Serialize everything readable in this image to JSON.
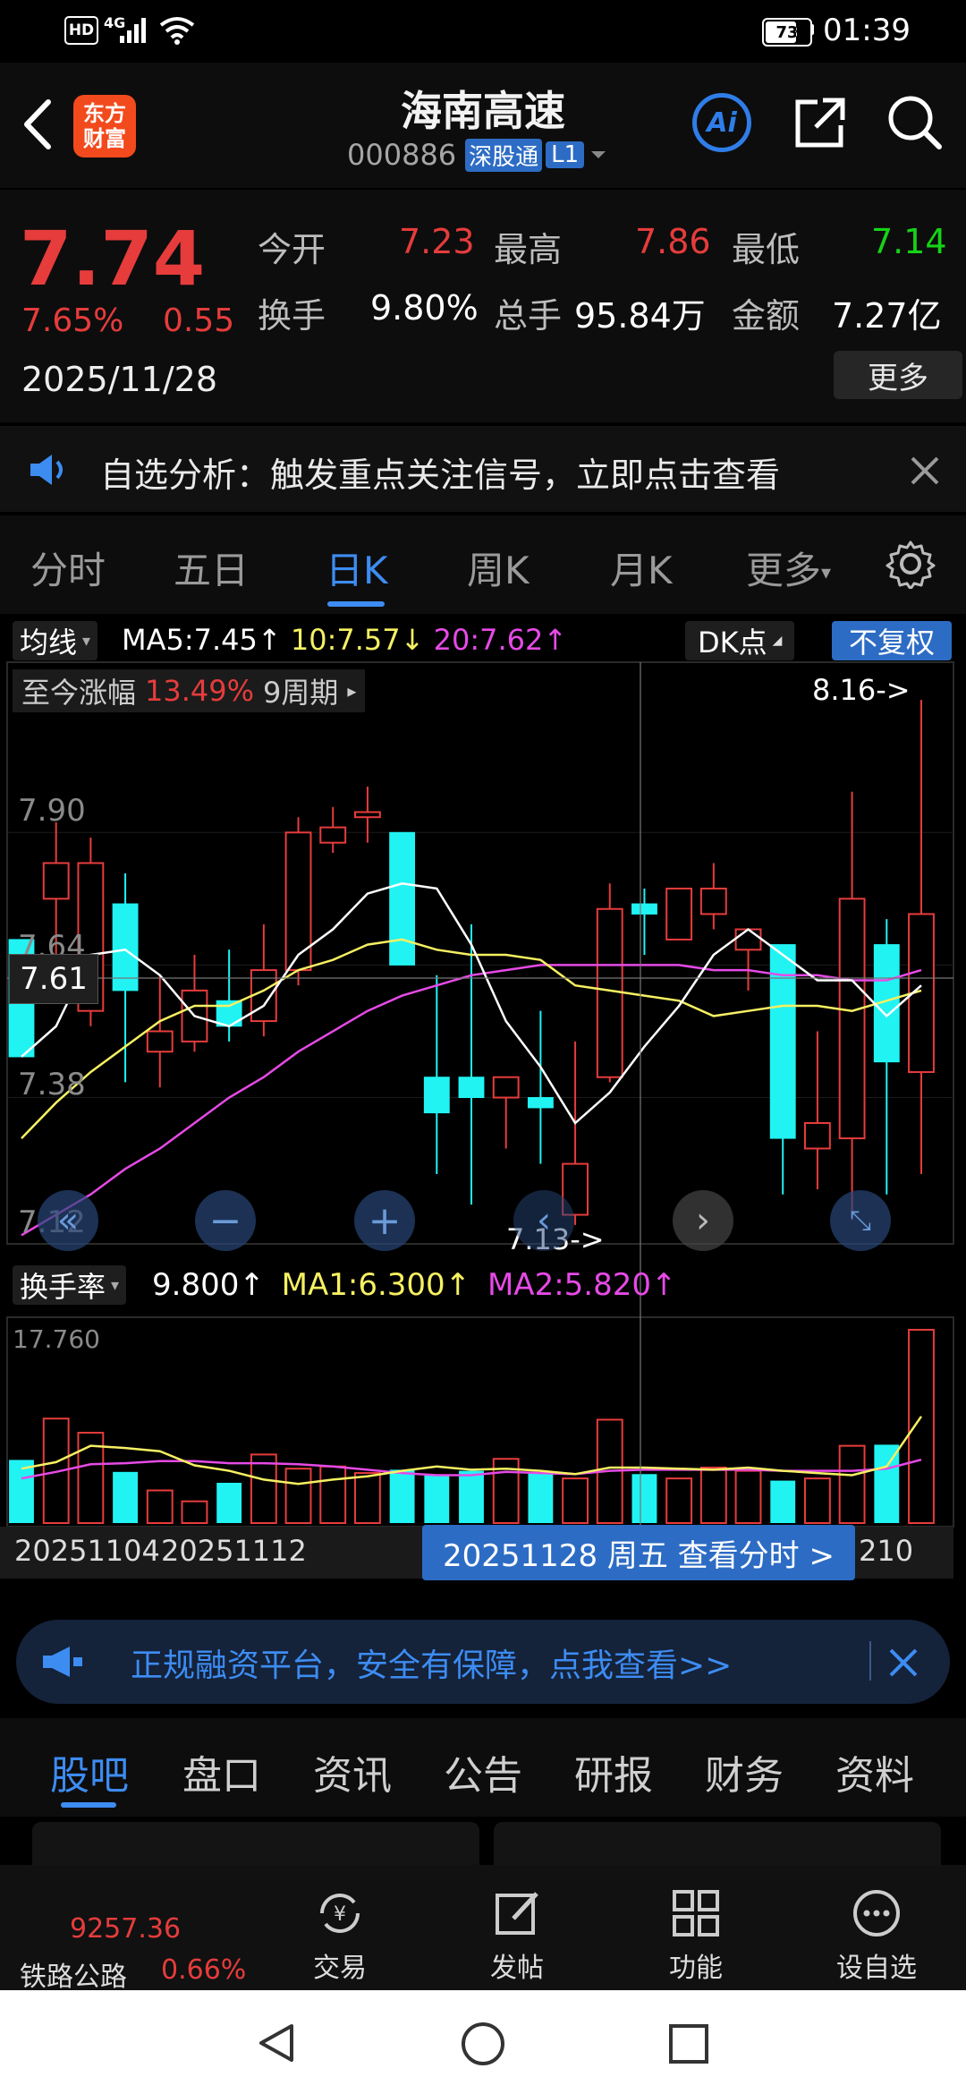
{
  "status": {
    "time": "01:39",
    "battery": "73",
    "network": "4G",
    "hd": "HD"
  },
  "header": {
    "logo_line1": "东方",
    "logo_line2": "财富",
    "stock_name": "海南高速",
    "stock_code": "000886",
    "tag_market": "深股通",
    "tag_level": "L1",
    "ai_label": "Ai"
  },
  "quote": {
    "price": "7.74",
    "change_pct": "7.65%",
    "change_abs": "0.55",
    "date": "2025/11/28",
    "open_label": "今开",
    "open": "7.23",
    "high_label": "最高",
    "high": "7.86",
    "low_label": "最低",
    "low": "7.14",
    "turnover_label": "换手",
    "turnover": "9.80%",
    "volume_label": "总手",
    "volume": "95.84万",
    "amount_label": "金额",
    "amount": "7.27亿",
    "more_label": "更多"
  },
  "notice": {
    "text": "自选分析：触发重点关注信号，立即点击查看"
  },
  "tabs": {
    "items": [
      "分时",
      "五日",
      "日K",
      "周K",
      "月K",
      "更多"
    ],
    "active": "日K"
  },
  "kline": {
    "indicator_label": "均线",
    "ma5": "MA5:7.45↑",
    "ma10": "10:7.57↓",
    "ma20": "20:7.62↑",
    "dk_label": "DK点",
    "adjust_label": "不复权",
    "period_label": "至今涨幅",
    "period_pct": "13.49%",
    "period_cycle": "9周期",
    "high_marker": "8.16->",
    "low_marker": "7.13->",
    "y_ticks": [
      "7.90",
      "7.64",
      "7.38",
      "7.12"
    ],
    "crosshair_price": "7.61",
    "sub_indicator": "换手率",
    "sub_val": "9.800↑",
    "sub_ma1": "MA1:6.300↑",
    "sub_ma2": "MA2:5.820↑",
    "sub_max": "17.760",
    "x_labels": [
      "20251104",
      "20251112",
      "210"
    ],
    "tooltip": "20251128 周五 查看分时 >",
    "colors": {
      "up": "#e63c3c",
      "down": "#21f3f3",
      "ma5": "#ffffff",
      "ma10": "#f6f062",
      "ma20": "#e64ae6"
    }
  },
  "chart_data": {
    "type": "candlestick",
    "series": [
      {
        "o": 7.69,
        "h": 7.69,
        "l": 7.46,
        "c": 7.46
      },
      {
        "o": 7.77,
        "h": 7.92,
        "l": 7.6,
        "c": 7.84
      },
      {
        "o": 7.55,
        "h": 7.89,
        "l": 7.52,
        "c": 7.84
      },
      {
        "o": 7.76,
        "h": 7.82,
        "l": 7.41,
        "c": 7.59
      },
      {
        "o": 7.47,
        "h": 7.62,
        "l": 7.4,
        "c": 7.51
      },
      {
        "o": 7.49,
        "h": 7.66,
        "l": 7.47,
        "c": 7.59
      },
      {
        "o": 7.57,
        "h": 7.67,
        "l": 7.49,
        "c": 7.52
      },
      {
        "o": 7.53,
        "h": 7.72,
        "l": 7.5,
        "c": 7.63
      },
      {
        "o": 7.63,
        "h": 7.93,
        "l": 7.6,
        "c": 7.9
      },
      {
        "o": 7.88,
        "h": 7.95,
        "l": 7.86,
        "c": 7.91
      },
      {
        "o": 7.93,
        "h": 7.99,
        "l": 7.88,
        "c": 7.94
      },
      {
        "o": 7.9,
        "h": 7.9,
        "l": 7.64,
        "c": 7.64
      },
      {
        "o": 7.42,
        "h": 7.62,
        "l": 7.23,
        "c": 7.35
      },
      {
        "o": 7.42,
        "h": 7.72,
        "l": 7.17,
        "c": 7.38
      },
      {
        "o": 7.38,
        "h": 7.41,
        "l": 7.28,
        "c": 7.42
      },
      {
        "o": 7.38,
        "h": 7.55,
        "l": 7.25,
        "c": 7.36
      },
      {
        "o": 7.15,
        "h": 7.49,
        "l": 7.13,
        "c": 7.25
      },
      {
        "o": 7.42,
        "h": 7.8,
        "l": 7.41,
        "c": 7.75
      },
      {
        "o": 7.76,
        "h": 7.79,
        "l": 7.66,
        "c": 7.74
      },
      {
        "o": 7.69,
        "h": 7.77,
        "l": 7.69,
        "c": 7.79
      },
      {
        "o": 7.74,
        "h": 7.84,
        "l": 7.71,
        "c": 7.79
      },
      {
        "o": 7.67,
        "h": 7.71,
        "l": 7.59,
        "c": 7.71
      },
      {
        "o": 7.68,
        "h": 7.68,
        "l": 7.19,
        "c": 7.3
      },
      {
        "o": 7.28,
        "h": 7.51,
        "l": 7.2,
        "c": 7.33
      },
      {
        "o": 7.3,
        "h": 7.98,
        "l": 7.14,
        "c": 7.77
      },
      {
        "o": 7.68,
        "h": 7.73,
        "l": 7.19,
        "c": 7.45
      },
      {
        "o": 7.43,
        "h": 8.16,
        "l": 7.23,
        "c": 7.74
      }
    ],
    "ma5": [
      7.46,
      7.52,
      7.66,
      7.67,
      7.62,
      7.54,
      7.52,
      7.56,
      7.66,
      7.71,
      7.78,
      7.8,
      7.79,
      7.68,
      7.53,
      7.44,
      7.33,
      7.39,
      7.48,
      7.56,
      7.66,
      7.71,
      7.66,
      7.61,
      7.61,
      7.54,
      7.6
    ],
    "ma10": [
      7.3,
      7.37,
      7.43,
      7.48,
      7.53,
      7.56,
      7.56,
      7.59,
      7.63,
      7.65,
      7.68,
      7.69,
      7.67,
      7.66,
      7.66,
      7.65,
      7.6,
      7.59,
      7.58,
      7.57,
      7.54,
      7.55,
      7.56,
      7.56,
      7.55,
      7.57,
      7.59
    ],
    "ma20": [
      7.11,
      7.15,
      7.19,
      7.24,
      7.28,
      7.33,
      7.38,
      7.42,
      7.47,
      7.51,
      7.55,
      7.58,
      7.6,
      7.62,
      7.63,
      7.64,
      7.64,
      7.64,
      7.64,
      7.64,
      7.63,
      7.63,
      7.62,
      7.62,
      7.61,
      7.61,
      7.63
    ],
    "turnover": [
      5.8,
      9.6,
      8.3,
      4.7,
      3.0,
      2.0,
      3.7,
      6.3,
      5.0,
      5.2,
      4.6,
      4.9,
      4.4,
      4.8,
      5.9,
      4.6,
      4.1,
      9.5,
      4.5,
      4.1,
      5.1,
      4.8,
      3.9,
      4.1,
      7.1,
      7.2,
      17.76
    ],
    "turnover_ma1": [
      5.0,
      5.6,
      7.1,
      6.9,
      6.6,
      5.3,
      4.8,
      4.0,
      3.6,
      4.0,
      4.3,
      4.8,
      5.2,
      4.9,
      5.0,
      4.8,
      4.5,
      5.1,
      5.1,
      5.0,
      4.9,
      5.1,
      4.8,
      4.6,
      4.4,
      5.2,
      9.8
    ],
    "turnover_ma2": [
      4.1,
      4.7,
      5.4,
      5.5,
      5.7,
      5.7,
      5.5,
      5.5,
      5.4,
      5.2,
      4.9,
      4.6,
      4.4,
      4.4,
      4.7,
      4.6,
      4.5,
      4.8,
      4.9,
      4.9,
      4.9,
      4.9,
      4.8,
      4.8,
      4.8,
      5.0,
      5.82
    ],
    "ylim": [
      7.1,
      8.22
    ],
    "sub_ylim": [
      0,
      17.76
    ]
  },
  "banner": {
    "text": "正规融资平台，安全有保障，点我查看>>"
  },
  "bottom_tabs": {
    "items": [
      "股吧",
      "盘口",
      "资讯",
      "公告",
      "研报",
      "财务",
      "资料"
    ],
    "active": "股吧"
  },
  "navbar": {
    "index_value": "9257.36",
    "index_name": "铁路公路",
    "index_pct": "0.66%",
    "items": [
      "交易",
      "发帖",
      "功能",
      "设自选"
    ]
  }
}
